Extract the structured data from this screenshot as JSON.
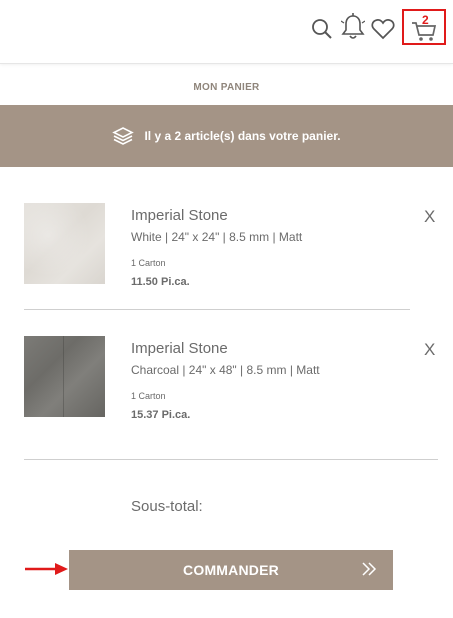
{
  "header": {
    "cart_count": "2",
    "icons": [
      "search-icon",
      "bell-icon",
      "heart-icon",
      "cart-icon"
    ]
  },
  "panel": {
    "title": "MON PANIER",
    "banner_text": "Il y a 2 article(s) dans votre panier."
  },
  "items": [
    {
      "name": "Imperial Stone",
      "spec": "White | 24\" x 24\" | 8.5 mm | Matt",
      "quantity": "1 Carton",
      "area": "11.50 Pi.ca.",
      "remove": "X"
    },
    {
      "name": "Imperial Stone",
      "spec": "Charcoal | 24\" x 48\" | 8.5 mm | Matt",
      "quantity": "1 Carton",
      "area": "15.37 Pi.ca.",
      "remove": "X"
    }
  ],
  "summary": {
    "subtotal_label": "Sous-total:"
  },
  "checkout": {
    "label": "COMMANDER"
  },
  "colors": {
    "accent": "#a49486",
    "highlight_red": "#e01a1a",
    "text": "#6b6b6b"
  }
}
